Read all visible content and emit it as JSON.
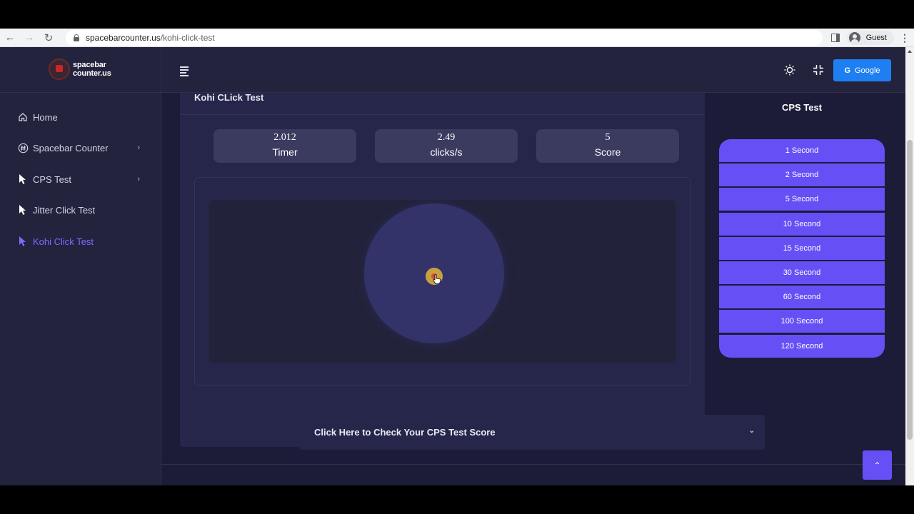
{
  "browser": {
    "url_host": "spacebarcounter.us",
    "url_path": "/kohi-click-test",
    "profile_label": "Guest"
  },
  "sidebar": {
    "logo_line1": "spacebar",
    "logo_line2": "counter.us",
    "items": [
      {
        "label": "Home",
        "icon": "home-icon",
        "has_submenu": false,
        "active": false
      },
      {
        "label": "Spacebar Counter",
        "icon": "hash-icon",
        "has_submenu": true,
        "active": false
      },
      {
        "label": "CPS Test",
        "icon": "cursor-icon",
        "has_submenu": true,
        "active": false
      },
      {
        "label": "Jitter Click Test",
        "icon": "cursor-icon",
        "has_submenu": false,
        "active": false
      },
      {
        "label": "Kohi Click Test",
        "icon": "cursor-icon",
        "has_submenu": false,
        "active": true
      }
    ]
  },
  "header": {
    "google_label": "Google"
  },
  "main": {
    "title": "Kohi CLick Test",
    "stats": [
      {
        "value": "2.012",
        "label": "Timer"
      },
      {
        "value": "2.49",
        "label": "clicks/s"
      },
      {
        "value": "5",
        "label": "Score"
      }
    ]
  },
  "cps_panel": {
    "title": "CPS Test",
    "options": [
      "1 Second",
      "2 Second",
      "5 Second",
      "10 Second",
      "15 Second",
      "30 Second",
      "60 Second",
      "100 Second",
      "120 Second"
    ]
  },
  "accordion": {
    "label": "Click Here to Check Your CPS Test Score"
  },
  "colors": {
    "accent": "#6650f5",
    "active_menu": "#7b6cff",
    "google_button": "#1e7ff2",
    "page_background": "#1c1b38"
  }
}
